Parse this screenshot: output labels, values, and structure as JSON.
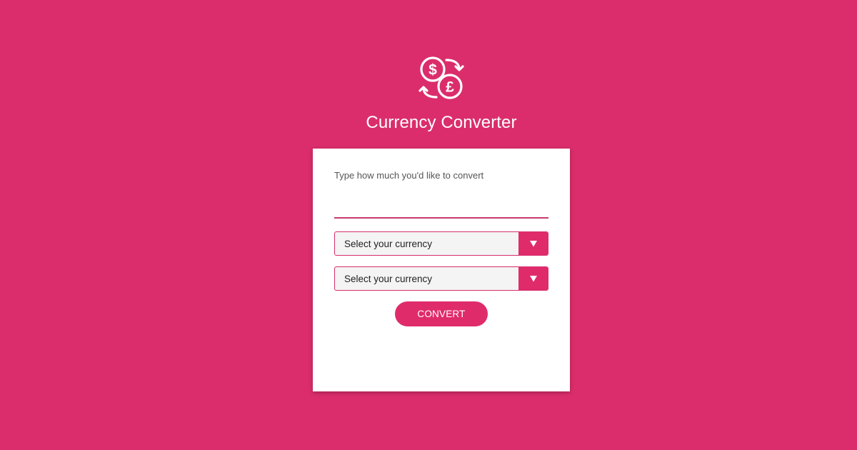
{
  "header": {
    "logo_icon": "currency-exchange-icon",
    "title": "Currency Converter"
  },
  "form": {
    "prompt": "Type how much you'd like to convert",
    "amount": {
      "value": "",
      "placeholder": ""
    },
    "from_currency": {
      "selected": "Select your currency",
      "icon": "triangle-down-icon"
    },
    "to_currency": {
      "selected": "Select your currency",
      "icon": "triangle-down-icon"
    },
    "convert_label": "CONVERT"
  },
  "colors": {
    "background": "#db2d6c",
    "accent": "#e02b6b",
    "card": "#ffffff",
    "select_bg": "#f4f4f4"
  }
}
